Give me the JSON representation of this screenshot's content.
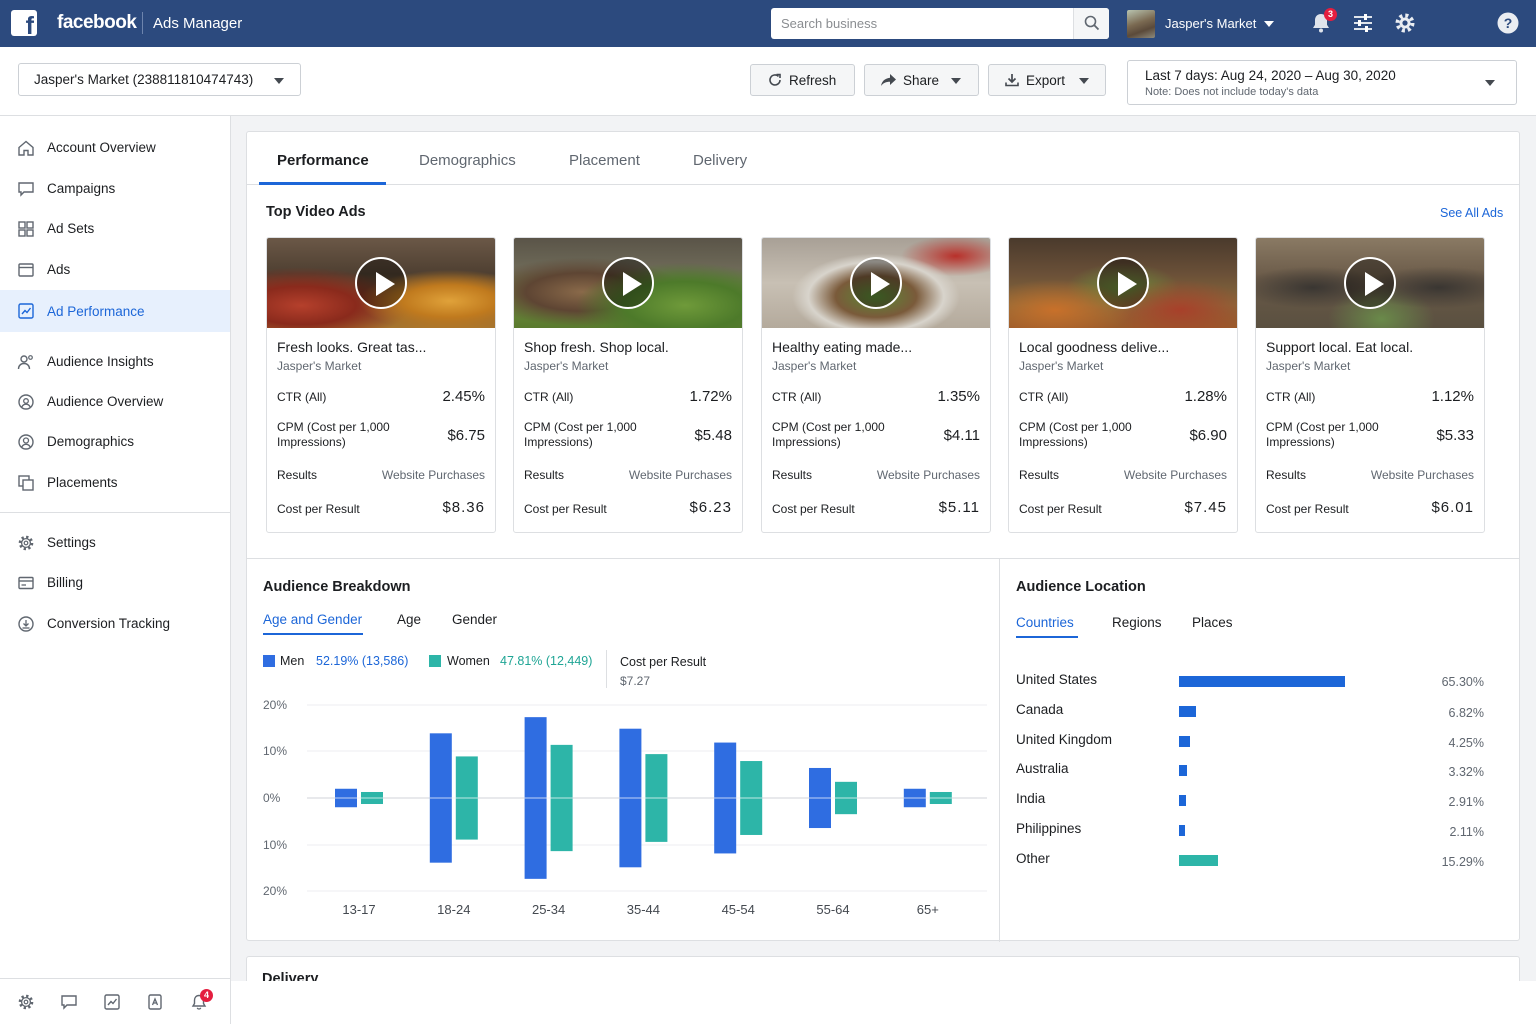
{
  "topbar": {
    "brand": "facebook",
    "app_name": "Ads Manager",
    "search_placeholder": "Search business",
    "account_name": "Jasper's Market",
    "notification_count": "3"
  },
  "header": {
    "account_select": "Jasper's Market (238811810474743)",
    "refresh_label": "Refresh",
    "share_label": "Share",
    "export_label": "Export",
    "date_range": "Last 7 days: Aug 24, 2020 – Aug 30, 2020",
    "date_note": "Note: Does not include today's data"
  },
  "sidebar": {
    "items": [
      {
        "label": "Account Overview",
        "icon": "home-icon"
      },
      {
        "label": "Campaigns",
        "icon": "campaigns-icon"
      },
      {
        "label": "Ad Sets",
        "icon": "grid-icon"
      },
      {
        "label": "Ads",
        "icon": "ad-icon"
      },
      {
        "label": "Ad Performance",
        "icon": "chart-icon",
        "active": true
      },
      {
        "label": "Audience Insights",
        "icon": "people-icon"
      },
      {
        "label": "Audience Overview",
        "icon": "target-icon"
      },
      {
        "label": "Demographics",
        "icon": "person-circle-icon"
      },
      {
        "label": "Placements",
        "icon": "placements-icon"
      },
      {
        "label": "Settings",
        "icon": "gear-icon"
      },
      {
        "label": "Billing",
        "icon": "billing-icon"
      },
      {
        "label": "Conversion Tracking",
        "icon": "conversion-icon"
      }
    ],
    "bottom_badge": "4"
  },
  "main": {
    "tabs": [
      "Performance",
      "Demographics",
      "Placement",
      "Delivery"
    ],
    "top_video_title": "Top Video Ads",
    "see_all": "See All Ads",
    "metric_labels": {
      "ctr": "CTR (All)",
      "cpm": "CPM (Cost per 1,000 Impressions)",
      "results": "Results",
      "cost_per_result": "Cost per Result"
    },
    "ads": [
      {
        "title": "Fresh looks. Great tas...",
        "advertiser": "Jasper's Market",
        "ctr": "2.45%",
        "cpm": "$6.75",
        "results": "Website Purchases",
        "cost_per_result": "$8.36"
      },
      {
        "title": "Shop fresh. Shop local.",
        "advertiser": "Jasper's Market",
        "ctr": "1.72%",
        "cpm": "$5.48",
        "results": "Website Purchases",
        "cost_per_result": "$6.23"
      },
      {
        "title": "Healthy eating made...",
        "advertiser": "Jasper's Market",
        "ctr": "1.35%",
        "cpm": "$4.11",
        "results": "Website Purchases",
        "cost_per_result": "$5.11"
      },
      {
        "title": "Local goodness delive...",
        "advertiser": "Jasper's Market",
        "ctr": "1.28%",
        "cpm": "$6.90",
        "results": "Website Purchases",
        "cost_per_result": "$7.45"
      },
      {
        "title": "Support local. Eat local.",
        "advertiser": "Jasper's Market",
        "ctr": "1.12%",
        "cpm": "$5.33",
        "results": "Website Purchases",
        "cost_per_result": "$6.01"
      }
    ],
    "breakdown": {
      "title": "Audience Breakdown",
      "tabs": [
        "Age and Gender",
        "Age",
        "Gender"
      ],
      "men_label": "Men",
      "men_value": "52.19% (13,586)",
      "women_label": "Women",
      "women_value": "47.81% (12,449)",
      "cost_label": "Cost per Result",
      "cost_value": "$7.27"
    },
    "location": {
      "title": "Audience Location",
      "tabs": [
        "Countries",
        "Regions",
        "Places"
      ],
      "rows": [
        {
          "name": "United States",
          "pct": "65.30%",
          "value": 65.3
        },
        {
          "name": "Canada",
          "pct": "6.82%",
          "value": 6.82
        },
        {
          "name": "United Kingdom",
          "pct": "4.25%",
          "value": 4.25
        },
        {
          "name": "Australia",
          "pct": "3.32%",
          "value": 3.32
        },
        {
          "name": "India",
          "pct": "2.91%",
          "value": 2.91
        },
        {
          "name": "Philippines",
          "pct": "2.11%",
          "value": 2.11
        },
        {
          "name": "Other",
          "pct": "15.29%",
          "value": 15.29
        }
      ]
    },
    "delivery_title": "Delivery"
  },
  "colors": {
    "topbar": "#2c4a7e",
    "accent": "#1c66d8",
    "men": "#2f6de1",
    "women": "#2db5a8"
  },
  "chart_data": {
    "type": "bar",
    "categories": [
      "13-17",
      "18-24",
      "25-34",
      "35-44",
      "45-54",
      "55-64",
      "65+"
    ],
    "series": [
      {
        "name": "Men",
        "values": [
          2.0,
          14.0,
          17.5,
          15.0,
          12.0,
          6.5,
          2.0
        ]
      },
      {
        "name": "Women",
        "values": [
          1.3,
          9.0,
          11.5,
          9.5,
          8.0,
          3.5,
          1.3
        ]
      }
    ],
    "ytick_labels": [
      "20%",
      "10%",
      "0%",
      "10%",
      "20%"
    ],
    "ylim": [
      -20,
      20
    ],
    "grid": true,
    "note": "bars mirrored above and below the 0% line"
  }
}
